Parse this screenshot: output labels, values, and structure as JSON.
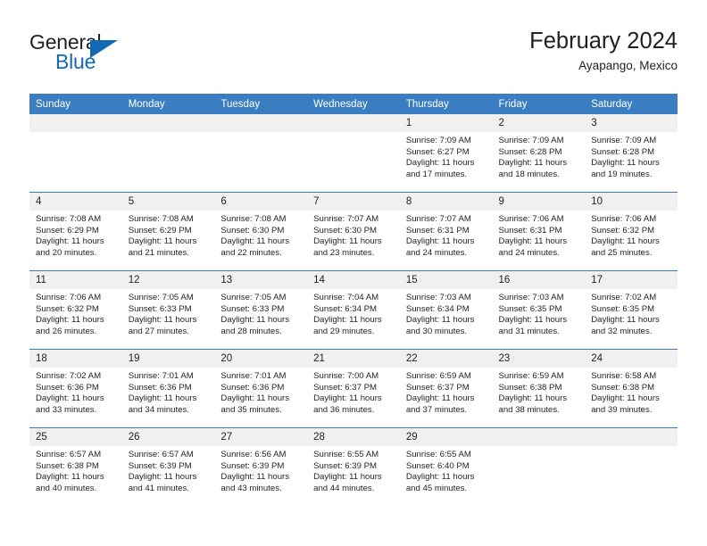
{
  "brand": {
    "name_top": "General",
    "name_bottom": "Blue",
    "triangle_color": "#1268b3",
    "text_color": "#231f20"
  },
  "header": {
    "title": "February 2024",
    "location": "Ayapango, Mexico"
  },
  "theme": {
    "header_blue": "#3a7dc0",
    "daynum_band": "#f0f0f0",
    "text": "#231f20"
  },
  "weekday_headers": [
    "Sunday",
    "Monday",
    "Tuesday",
    "Wednesday",
    "Thursday",
    "Friday",
    "Saturday"
  ],
  "labels": {
    "sunrise_prefix": "Sunrise:",
    "sunset_prefix": "Sunset:",
    "daylight_prefix": "Daylight:"
  },
  "weeks": [
    [
      {
        "blank": true,
        "day": ""
      },
      {
        "blank": true,
        "day": ""
      },
      {
        "blank": true,
        "day": ""
      },
      {
        "blank": true,
        "day": ""
      },
      {
        "blank": false,
        "day": "1",
        "sunrise": "Sunrise: 7:09 AM",
        "sunset": "Sunset: 6:27 PM",
        "daylight_1": "Daylight: 11 hours",
        "daylight_2": "and 17 minutes."
      },
      {
        "blank": false,
        "day": "2",
        "sunrise": "Sunrise: 7:09 AM",
        "sunset": "Sunset: 6:28 PM",
        "daylight_1": "Daylight: 11 hours",
        "daylight_2": "and 18 minutes."
      },
      {
        "blank": false,
        "day": "3",
        "sunrise": "Sunrise: 7:09 AM",
        "sunset": "Sunset: 6:28 PM",
        "daylight_1": "Daylight: 11 hours",
        "daylight_2": "and 19 minutes."
      }
    ],
    [
      {
        "blank": false,
        "day": "4",
        "sunrise": "Sunrise: 7:08 AM",
        "sunset": "Sunset: 6:29 PM",
        "daylight_1": "Daylight: 11 hours",
        "daylight_2": "and 20 minutes."
      },
      {
        "blank": false,
        "day": "5",
        "sunrise": "Sunrise: 7:08 AM",
        "sunset": "Sunset: 6:29 PM",
        "daylight_1": "Daylight: 11 hours",
        "daylight_2": "and 21 minutes."
      },
      {
        "blank": false,
        "day": "6",
        "sunrise": "Sunrise: 7:08 AM",
        "sunset": "Sunset: 6:30 PM",
        "daylight_1": "Daylight: 11 hours",
        "daylight_2": "and 22 minutes."
      },
      {
        "blank": false,
        "day": "7",
        "sunrise": "Sunrise: 7:07 AM",
        "sunset": "Sunset: 6:30 PM",
        "daylight_1": "Daylight: 11 hours",
        "daylight_2": "and 23 minutes."
      },
      {
        "blank": false,
        "day": "8",
        "sunrise": "Sunrise: 7:07 AM",
        "sunset": "Sunset: 6:31 PM",
        "daylight_1": "Daylight: 11 hours",
        "daylight_2": "and 24 minutes."
      },
      {
        "blank": false,
        "day": "9",
        "sunrise": "Sunrise: 7:06 AM",
        "sunset": "Sunset: 6:31 PM",
        "daylight_1": "Daylight: 11 hours",
        "daylight_2": "and 24 minutes."
      },
      {
        "blank": false,
        "day": "10",
        "sunrise": "Sunrise: 7:06 AM",
        "sunset": "Sunset: 6:32 PM",
        "daylight_1": "Daylight: 11 hours",
        "daylight_2": "and 25 minutes."
      }
    ],
    [
      {
        "blank": false,
        "day": "11",
        "sunrise": "Sunrise: 7:06 AM",
        "sunset": "Sunset: 6:32 PM",
        "daylight_1": "Daylight: 11 hours",
        "daylight_2": "and 26 minutes."
      },
      {
        "blank": false,
        "day": "12",
        "sunrise": "Sunrise: 7:05 AM",
        "sunset": "Sunset: 6:33 PM",
        "daylight_1": "Daylight: 11 hours",
        "daylight_2": "and 27 minutes."
      },
      {
        "blank": false,
        "day": "13",
        "sunrise": "Sunrise: 7:05 AM",
        "sunset": "Sunset: 6:33 PM",
        "daylight_1": "Daylight: 11 hours",
        "daylight_2": "and 28 minutes."
      },
      {
        "blank": false,
        "day": "14",
        "sunrise": "Sunrise: 7:04 AM",
        "sunset": "Sunset: 6:34 PM",
        "daylight_1": "Daylight: 11 hours",
        "daylight_2": "and 29 minutes."
      },
      {
        "blank": false,
        "day": "15",
        "sunrise": "Sunrise: 7:03 AM",
        "sunset": "Sunset: 6:34 PM",
        "daylight_1": "Daylight: 11 hours",
        "daylight_2": "and 30 minutes."
      },
      {
        "blank": false,
        "day": "16",
        "sunrise": "Sunrise: 7:03 AM",
        "sunset": "Sunset: 6:35 PM",
        "daylight_1": "Daylight: 11 hours",
        "daylight_2": "and 31 minutes."
      },
      {
        "blank": false,
        "day": "17",
        "sunrise": "Sunrise: 7:02 AM",
        "sunset": "Sunset: 6:35 PM",
        "daylight_1": "Daylight: 11 hours",
        "daylight_2": "and 32 minutes."
      }
    ],
    [
      {
        "blank": false,
        "day": "18",
        "sunrise": "Sunrise: 7:02 AM",
        "sunset": "Sunset: 6:36 PM",
        "daylight_1": "Daylight: 11 hours",
        "daylight_2": "and 33 minutes."
      },
      {
        "blank": false,
        "day": "19",
        "sunrise": "Sunrise: 7:01 AM",
        "sunset": "Sunset: 6:36 PM",
        "daylight_1": "Daylight: 11 hours",
        "daylight_2": "and 34 minutes."
      },
      {
        "blank": false,
        "day": "20",
        "sunrise": "Sunrise: 7:01 AM",
        "sunset": "Sunset: 6:36 PM",
        "daylight_1": "Daylight: 11 hours",
        "daylight_2": "and 35 minutes."
      },
      {
        "blank": false,
        "day": "21",
        "sunrise": "Sunrise: 7:00 AM",
        "sunset": "Sunset: 6:37 PM",
        "daylight_1": "Daylight: 11 hours",
        "daylight_2": "and 36 minutes."
      },
      {
        "blank": false,
        "day": "22",
        "sunrise": "Sunrise: 6:59 AM",
        "sunset": "Sunset: 6:37 PM",
        "daylight_1": "Daylight: 11 hours",
        "daylight_2": "and 37 minutes."
      },
      {
        "blank": false,
        "day": "23",
        "sunrise": "Sunrise: 6:59 AM",
        "sunset": "Sunset: 6:38 PM",
        "daylight_1": "Daylight: 11 hours",
        "daylight_2": "and 38 minutes."
      },
      {
        "blank": false,
        "day": "24",
        "sunrise": "Sunrise: 6:58 AM",
        "sunset": "Sunset: 6:38 PM",
        "daylight_1": "Daylight: 11 hours",
        "daylight_2": "and 39 minutes."
      }
    ],
    [
      {
        "blank": false,
        "day": "25",
        "sunrise": "Sunrise: 6:57 AM",
        "sunset": "Sunset: 6:38 PM",
        "daylight_1": "Daylight: 11 hours",
        "daylight_2": "and 40 minutes."
      },
      {
        "blank": false,
        "day": "26",
        "sunrise": "Sunrise: 6:57 AM",
        "sunset": "Sunset: 6:39 PM",
        "daylight_1": "Daylight: 11 hours",
        "daylight_2": "and 41 minutes."
      },
      {
        "blank": false,
        "day": "27",
        "sunrise": "Sunrise: 6:56 AM",
        "sunset": "Sunset: 6:39 PM",
        "daylight_1": "Daylight: 11 hours",
        "daylight_2": "and 43 minutes."
      },
      {
        "blank": false,
        "day": "28",
        "sunrise": "Sunrise: 6:55 AM",
        "sunset": "Sunset: 6:39 PM",
        "daylight_1": "Daylight: 11 hours",
        "daylight_2": "and 44 minutes."
      },
      {
        "blank": false,
        "day": "29",
        "sunrise": "Sunrise: 6:55 AM",
        "sunset": "Sunset: 6:40 PM",
        "daylight_1": "Daylight: 11 hours",
        "daylight_2": "and 45 minutes."
      },
      {
        "blank": true,
        "day": ""
      },
      {
        "blank": true,
        "day": ""
      }
    ]
  ]
}
